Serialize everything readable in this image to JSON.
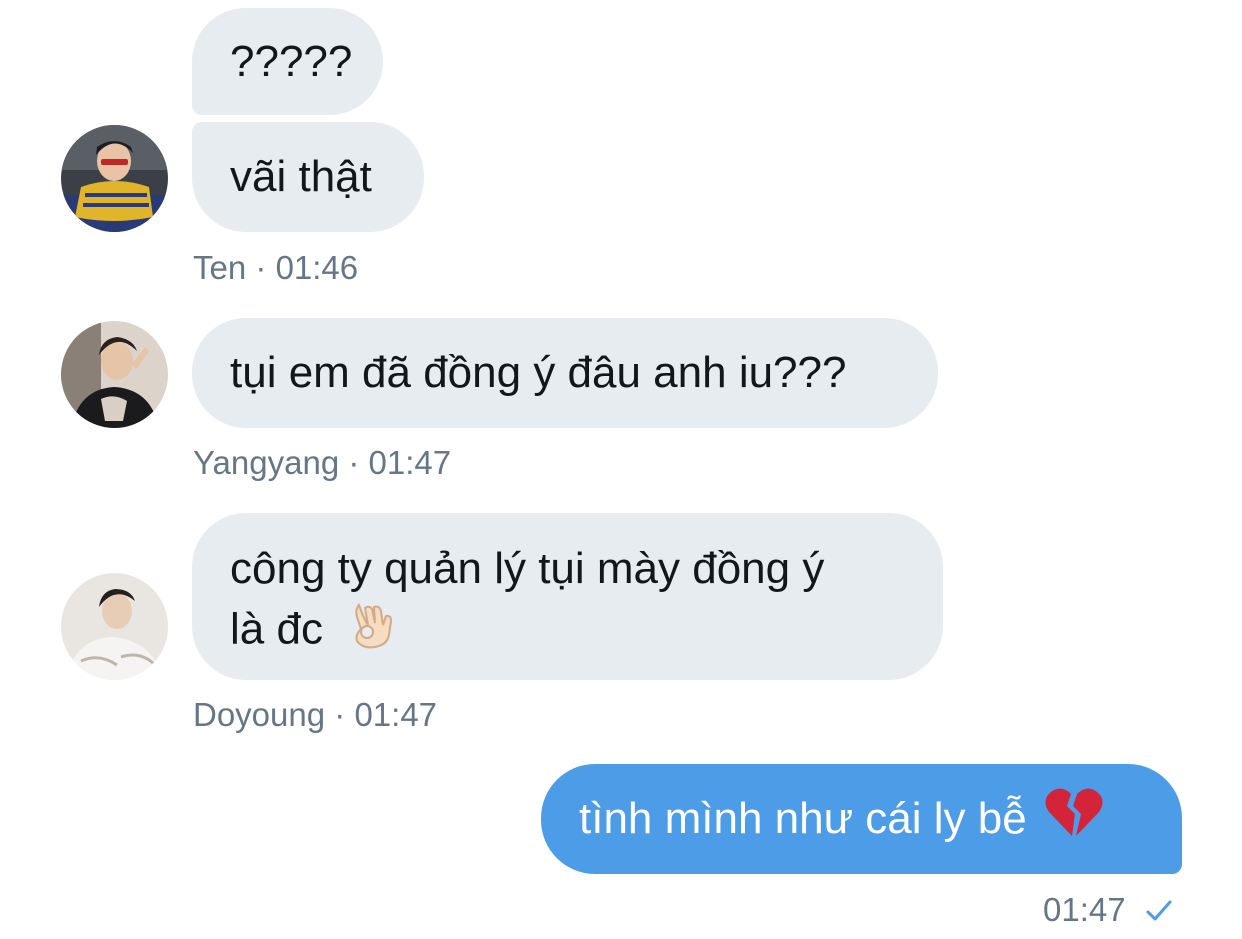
{
  "messages": [
    {
      "text": "?????"
    },
    {
      "text": "vãi thật"
    },
    {
      "text": "tụi em đã đồng ý đâu anh iu???"
    },
    {
      "text": "công ty quản lý tụi mày đồng ý",
      "text2": "là đc",
      "emoji": "ok-hand-emoji"
    },
    {
      "text": "tình mình như cái ly bễ",
      "emoji": "broken-heart-emoji"
    }
  ],
  "meta": {
    "ten": {
      "sender": "Ten",
      "sep": "·",
      "time": "01:46"
    },
    "yangyang": {
      "sender": "Yangyang",
      "sep": "·",
      "time": "01:47"
    },
    "doyoung": {
      "sender": "Doyoung",
      "sep": "·",
      "time": "01:47"
    },
    "own": {
      "time": "01:47",
      "status_icon": "checkmark-icon"
    }
  },
  "colors": {
    "incoming_bubble": "#e6ecf0",
    "outgoing_bubble": "#4d9ce8",
    "meta_text": "#657786",
    "check": "#4d9ce8"
  }
}
